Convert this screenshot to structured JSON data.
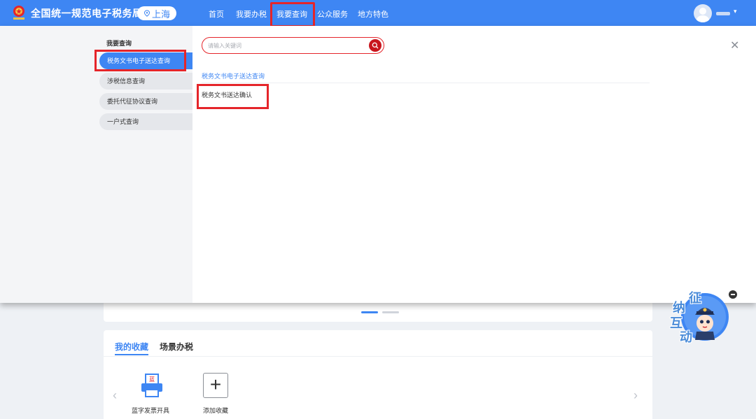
{
  "header": {
    "site_title": "全国统一规范电子税务局",
    "city": "上海",
    "nav": [
      "首页",
      "我要办税",
      "我要查询",
      "公众服务",
      "地方特色"
    ],
    "active_nav": "我要查询"
  },
  "dropdown": {
    "sidebar_title": "我要查询",
    "sidebar_items": [
      "税务文书电子送达查询",
      "涉税信息查询",
      "委托代征协议查询",
      "一户式查询"
    ],
    "active_item": "税务文书电子送达查询",
    "search_placeholder": "请输入关键词",
    "section_heading": "税务文书电子送达查询",
    "results": [
      "税务文书送达确认"
    ]
  },
  "favorites": {
    "tabs": [
      "我的收藏",
      "场景办税"
    ],
    "items": [
      {
        "label": "蓝字发票开具",
        "icon_text": "蓝",
        "icon": "invoice-printer-icon"
      },
      {
        "label": "添加收藏",
        "icon": "plus-icon"
      }
    ]
  },
  "floating_helper": {
    "chars": [
      "征",
      "纳",
      "互",
      "动"
    ]
  },
  "colors": {
    "primary": "#3e86f3",
    "highlight": "#e5252a",
    "search_button": "#c8161e"
  }
}
